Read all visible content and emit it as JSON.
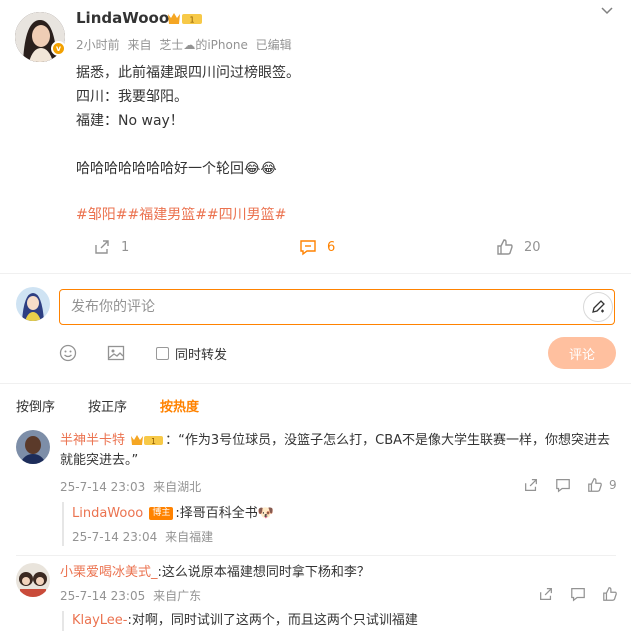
{
  "post": {
    "username": "LindaWooo",
    "level": "1",
    "time": "2小时前",
    "source_prefix": "来自",
    "source_name": "芝士",
    "source_suffix": "的iPhone",
    "edited": "已编辑",
    "lines": [
      "据悉，此前福建跟四川问过榜眼签。",
      "四川：我要邹阳。",
      "福建：No way！",
      "",
      "哈哈哈哈哈哈哈好一个轮回😂😂"
    ],
    "tags": "#邹阳##福建男篮##四川男篮#",
    "repost_count": "1",
    "comment_count": "6",
    "like_count": "20"
  },
  "composer": {
    "placeholder": "发布你的评论",
    "also_repost_label": "同时转发",
    "submit_label": "评论"
  },
  "sort": {
    "options": [
      "按倒序",
      "按正序",
      "按热度"
    ],
    "active": "按热度"
  },
  "comments": [
    {
      "name": "半神半卡特",
      "level": "1",
      "text": "：“作为3号位球员，没篮子怎么打，CBA不是像大学生联赛一样，你想突进去就能突进去。”",
      "time": "25-7-14 23:03",
      "location": "来自湖北",
      "likes": "9",
      "reply": {
        "name": "LindaWooo",
        "owner_tag": "博主",
        "text": ":择哥百科全书",
        "emoji": "🐶",
        "time": "25-7-14 23:04",
        "location": "来自福建"
      }
    },
    {
      "name": "小栗爱喝冰美式_",
      "text": ":这么说原本福建想同时拿下杨和李？",
      "time": "25-7-14 23:05",
      "location": "来自广东",
      "reply": {
        "name": "KlayLee-",
        "text": ":对啊，同时试训了这两个，而且这两个只试训福建"
      }
    }
  ],
  "colors": {
    "accent": "#ff8200",
    "link": "#eb7350",
    "meta": "#939393",
    "submit_disabled": "#ffc09f"
  }
}
